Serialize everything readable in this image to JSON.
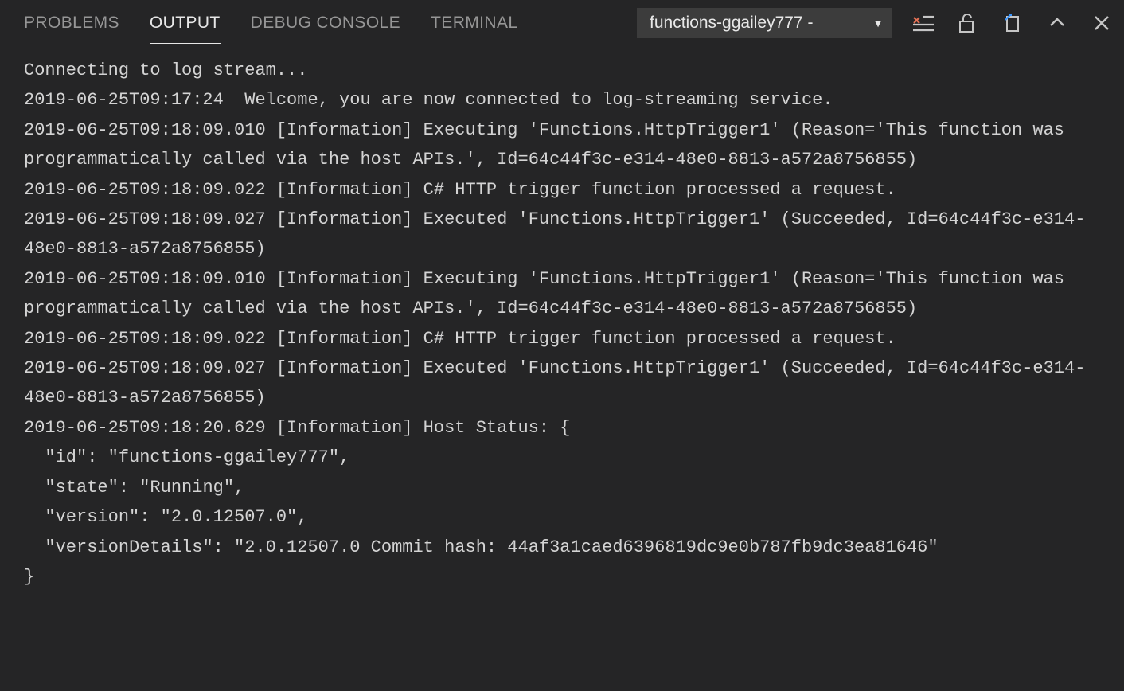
{
  "tabs": {
    "problems": "PROBLEMS",
    "output": "OUTPUT",
    "debug_console": "DEBUG CONSOLE",
    "terminal": "TERMINAL"
  },
  "dropdown": {
    "selected": "functions-ggailey777 -"
  },
  "log_lines": [
    "Connecting to log stream...",
    "2019-06-25T09:17:24  Welcome, you are now connected to log-streaming service.",
    "2019-06-25T09:18:09.010 [Information] Executing 'Functions.HttpTrigger1' (Reason='This function was programmatically called via the host APIs.', Id=64c44f3c-e314-48e0-8813-a572a8756855)",
    "2019-06-25T09:18:09.022 [Information] C# HTTP trigger function processed a request.",
    "2019-06-25T09:18:09.027 [Information] Executed 'Functions.HttpTrigger1' (Succeeded, Id=64c44f3c-e314-48e0-8813-a572a8756855)",
    "2019-06-25T09:18:09.010 [Information] Executing 'Functions.HttpTrigger1' (Reason='This function was programmatically called via the host APIs.', Id=64c44f3c-e314-48e0-8813-a572a8756855)",
    "2019-06-25T09:18:09.022 [Information] C# HTTP trigger function processed a request.",
    "2019-06-25T09:18:09.027 [Information] Executed 'Functions.HttpTrigger1' (Succeeded, Id=64c44f3c-e314-48e0-8813-a572a8756855)",
    "2019-06-25T09:18:20.629 [Information] Host Status: {",
    "  \"id\": \"functions-ggailey777\",",
    "  \"state\": \"Running\",",
    "  \"version\": \"2.0.12507.0\",",
    "  \"versionDetails\": \"2.0.12507.0 Commit hash: 44af3a1caed6396819dc9e0b787fb9dc3ea81646\"",
    "}"
  ]
}
